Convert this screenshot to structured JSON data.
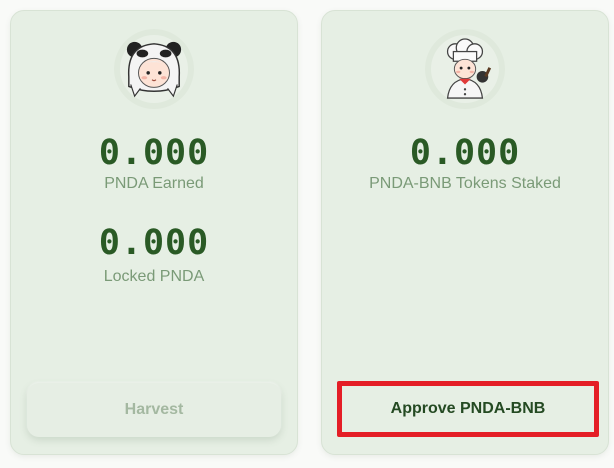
{
  "colors": {
    "card_background": "#e6efe4",
    "value_text": "#2a5a25",
    "label_text": "#7a9a77",
    "disabled_button_text": "#a4b8a1",
    "highlight_border": "#e41e26"
  },
  "earn_card": {
    "avatar_icon": "panda-hood-avatar-icon",
    "earned": {
      "value": "0.000",
      "label": "PNDA Earned"
    },
    "locked": {
      "value": "0.000",
      "label": "Locked PNDA"
    },
    "harvest_button": {
      "label": "Harvest",
      "disabled": true
    }
  },
  "stake_card": {
    "avatar_icon": "chef-avatar-icon",
    "staked": {
      "value": "0.000",
      "label": "PNDA-BNB Tokens Staked"
    },
    "approve_button": {
      "label": "Approve PNDA-BNB",
      "highlighted": true
    }
  }
}
